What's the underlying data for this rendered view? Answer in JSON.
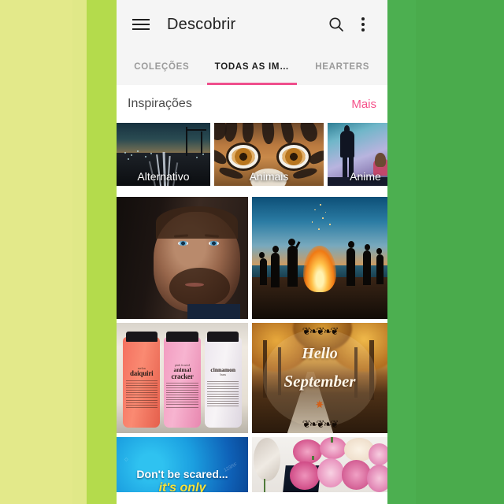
{
  "wallpaper": {
    "left_color": "#e3e98a",
    "left_accent": "#b4db4c",
    "right_color": "#4caf50"
  },
  "app": {
    "accent_color": "#ef4e8c",
    "appbar": {
      "menu_icon": "hamburger-menu-icon",
      "title": "Descobrir",
      "search_icon": "search-icon",
      "overflow_icon": "overflow-menu-icon"
    },
    "tabs": [
      {
        "label": "COLEÇÕES",
        "active": false
      },
      {
        "label": "TODAS AS IM…",
        "active": true
      },
      {
        "label": "HEARTERS",
        "active": false
      }
    ],
    "section": {
      "title": "Inspirações",
      "more_label": "Mais"
    },
    "inspirations": [
      {
        "label": "Alternativo",
        "art": "dusk-cityscape-light-trails"
      },
      {
        "label": "Animais",
        "art": "tiger-eyes-closeup"
      },
      {
        "label": "Anime",
        "art": "two-silhouettes-blue-sky"
      }
    ],
    "photo_grid": [
      {
        "name": "portrait-of-man-dark",
        "alt": "Close-up portrait of a bearded man with blue eyes in dark lighting"
      },
      {
        "name": "beach-bonfire-sunset",
        "alt": "Silhouettes of people around a bonfire on a beach at sunset"
      },
      {
        "name": "philosophy-shower-gel-bottles",
        "alt": "Three philosophy shower gel bottles",
        "bottles": [
          {
            "small": "melon",
            "large": "daiquiri"
          },
          {
            "small": "pink frosted",
            "large": "animal",
            "large2": "cracker"
          },
          {
            "large": "cinnamon",
            "small": "buns"
          }
        ]
      },
      {
        "name": "hello-september-autumn",
        "alt": "Autumn park scene with ornate script",
        "text_line1": "Hello",
        "text_line2": "September"
      },
      {
        "name": "dont-be-scared-blue",
        "alt": "Blue gradient poster",
        "text_line1": "Don't be scared...",
        "text_line2": "it's only"
      },
      {
        "name": "pink-peonies-mirror",
        "alt": "Bouquet of pink peonies next to a round mirror"
      }
    ]
  }
}
